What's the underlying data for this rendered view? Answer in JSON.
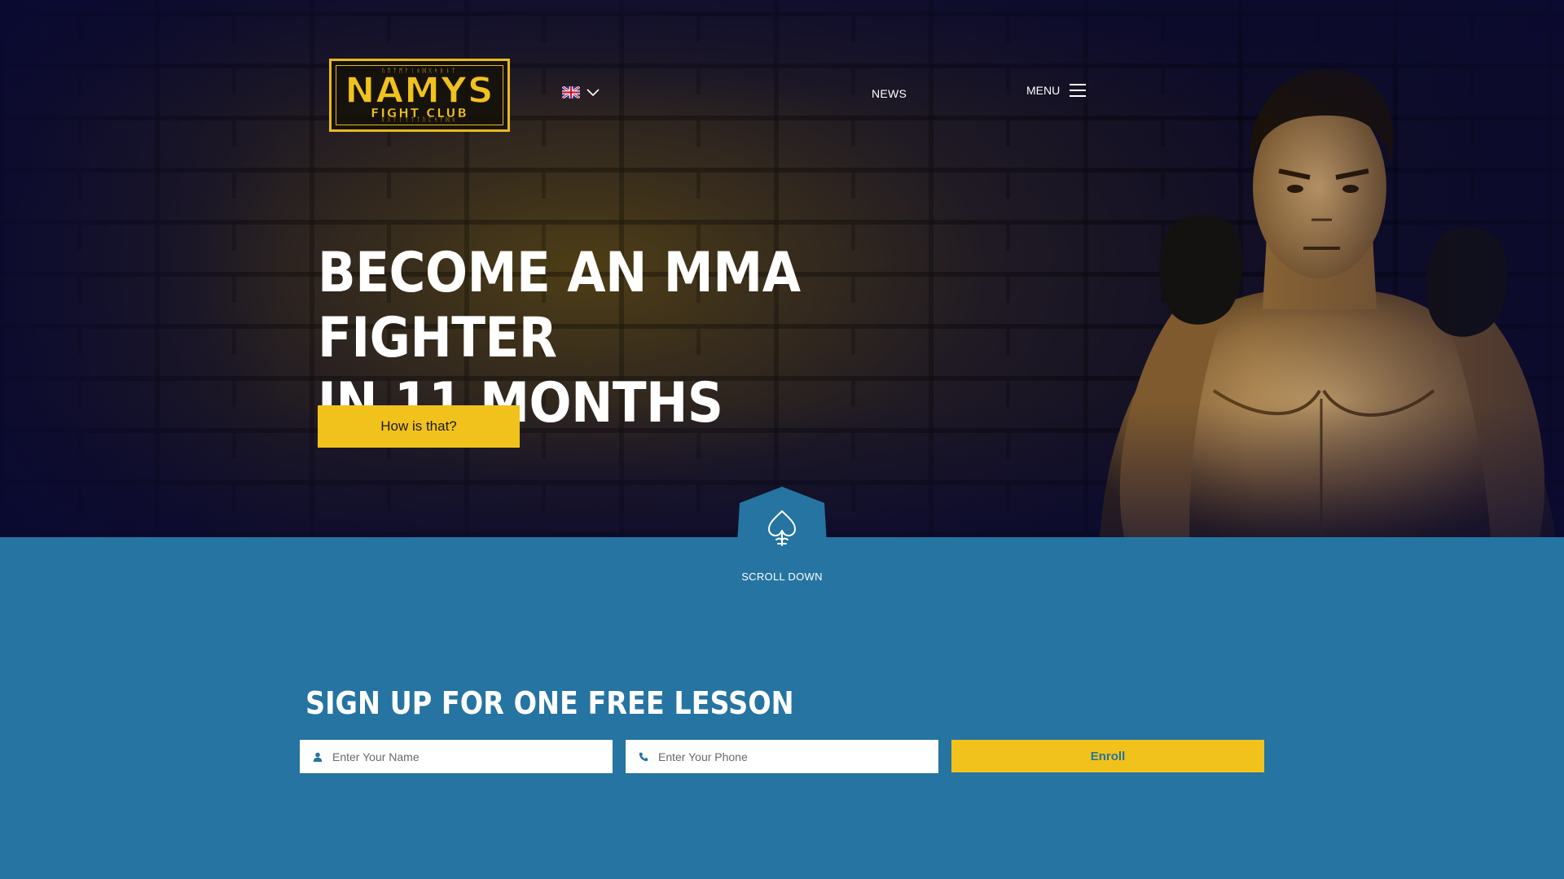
{
  "header": {
    "logo": {
      "title": "NAMYS",
      "subtitle": "FIGHT CLUB"
    },
    "language": {
      "selected": "English",
      "flag": "uk-flag-icon"
    },
    "nav": {
      "news": "NEWS",
      "menu": "MENU"
    }
  },
  "hero": {
    "title_line1": "BECOME AN MMA FIGHTER",
    "title_line2": "IN 11 MONTHS",
    "cta_label": "How is that?",
    "scroll_label": "SCROLL DOWN"
  },
  "signup": {
    "title": "SIGN UP FOR ONE FREE LESSON",
    "name_placeholder": "Enter Your Name",
    "phone_placeholder": "Enter Your Phone",
    "submit_label": "Enroll"
  },
  "colors": {
    "accent_yellow": "#f1c21b",
    "section_blue": "#2574a2",
    "hero_dark": "#14112c"
  },
  "icons": [
    "chevron-down-icon",
    "hamburger-icon",
    "spade-icon",
    "user-icon",
    "phone-icon"
  ]
}
